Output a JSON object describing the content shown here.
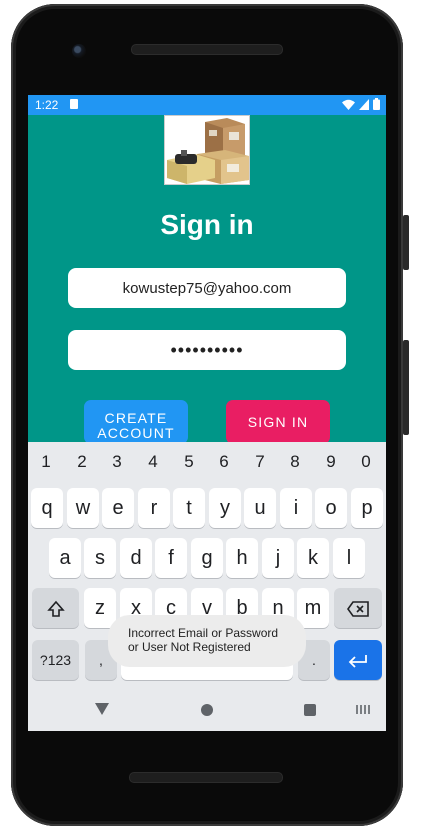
{
  "statusbar": {
    "time": "1:22",
    "icons": [
      "sd-card-icon",
      "wifi-icon",
      "signal-icon",
      "battery-icon"
    ],
    "color": "#2196f3"
  },
  "app": {
    "background": "#009688",
    "logo": "packing-boxes-logo",
    "title": "Sign in",
    "email_value": "kowustep75@yahoo.com",
    "password_value": "••••••••••",
    "create_account_label": "CREATE ACCOUNT",
    "sign_in_label": "SIGN IN",
    "create_color": "#2196f3",
    "signin_color": "#e91e63"
  },
  "keyboard": {
    "number_row": [
      "1",
      "2",
      "3",
      "4",
      "5",
      "6",
      "7",
      "8",
      "9",
      "0"
    ],
    "row1": [
      "q",
      "w",
      "e",
      "r",
      "t",
      "y",
      "u",
      "i",
      "o",
      "p"
    ],
    "row2": [
      "a",
      "s",
      "d",
      "f",
      "g",
      "h",
      "j",
      "k",
      "l"
    ],
    "row3": [
      "z",
      "x",
      "c",
      "v",
      "b",
      "n",
      "m"
    ],
    "symbols_label": "?123",
    "comma": ",",
    "period": "."
  },
  "toast": {
    "line1": "Incorrect Email or Password",
    "line2": "or User Not Registered"
  }
}
